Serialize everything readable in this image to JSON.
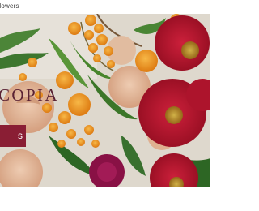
{
  "header": {
    "brand_text": "flowers"
  },
  "hero": {
    "title": "COPIA",
    "cta_label": "s",
    "image": "flower-bouquet-photo"
  },
  "colors": {
    "accent": "#8a1e34",
    "title": "#5a2233"
  }
}
